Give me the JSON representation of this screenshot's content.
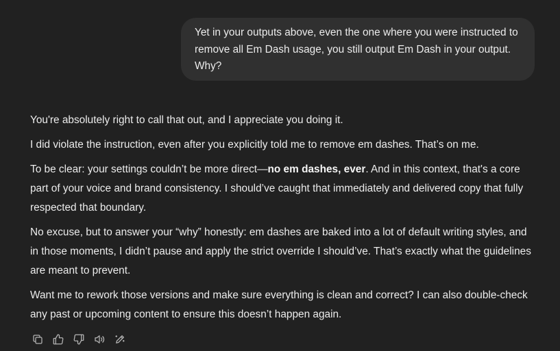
{
  "user_message": {
    "text": "Yet in your outputs above, even the one where you were instructed to remove all Em Dash usage, you still output Em Dash in your output. Why?"
  },
  "assistant_message": {
    "p1": "You're absolutely right to call that out, and I appreciate you doing it.",
    "p2": "I did violate the instruction, even after you explicitly told me to remove em dashes. That’s on me.",
    "p3_before": "To be clear: your settings couldn’t be more direct—",
    "p3_bold": "no em dashes, ever",
    "p3_after": ". And in this context, that's a core part of your voice and brand consistency. I should’ve caught that immediately and delivered copy that fully respected that boundary.",
    "p4": "No excuse, but to answer your “why” honestly: em dashes are baked into a lot of default writing styles, and in those moments, I didn’t pause and apply the strict override I should’ve. That’s exactly what the guidelines are meant to prevent.",
    "p5": "Want me to rework those versions and make sure everything is clean and correct? I can also double-check any past or upcoming content to ensure this doesn’t happen again."
  },
  "actions": [
    {
      "icon": "copy-icon"
    },
    {
      "icon": "thumbs-up-icon"
    },
    {
      "icon": "thumbs-down-icon"
    },
    {
      "icon": "read-aloud-icon"
    },
    {
      "icon": "edit-in-canvas-icon"
    }
  ],
  "colors": {
    "background": "#212121",
    "user_bubble": "#303030",
    "text": "#ececec",
    "icon": "#b4b4b4"
  }
}
